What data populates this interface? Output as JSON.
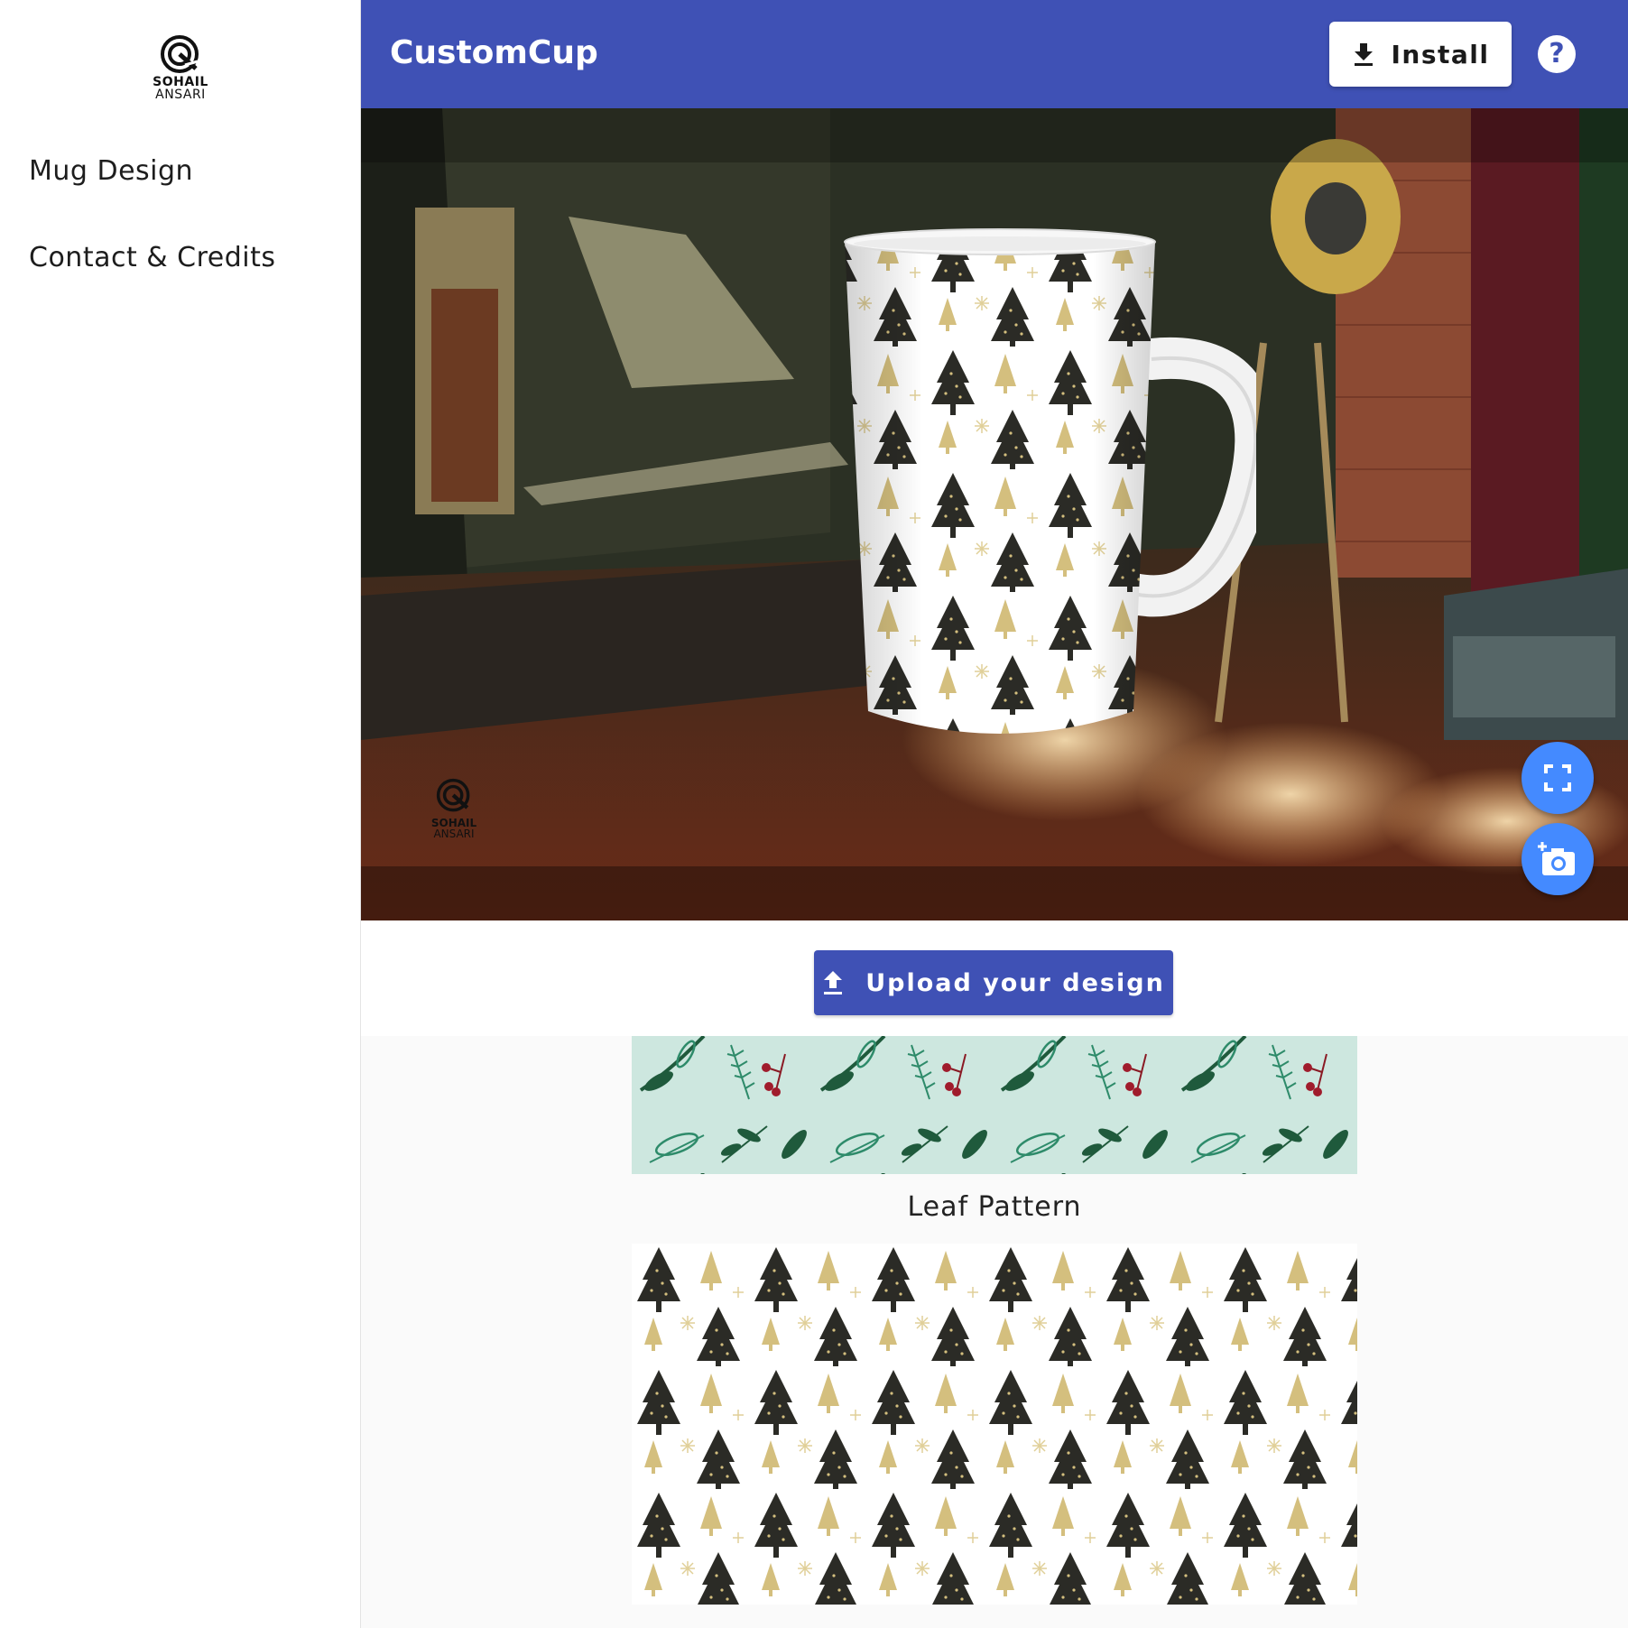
{
  "sidebar": {
    "brand": {
      "line1": "SOHAIL",
      "line2": "ANSARI"
    },
    "items": [
      {
        "label": "Mug Design"
      },
      {
        "label": "Contact & Credits"
      }
    ]
  },
  "header": {
    "title": "CustomCup",
    "install_label": "Install",
    "help_icon": "?"
  },
  "viewer": {
    "watermark": {
      "line1": "SOHAIL",
      "line2": "ANSARI"
    },
    "fullscreen_icon": "fullscreen-icon",
    "screenshot_icon": "add-photo-icon"
  },
  "upload": {
    "label": "Upload your design"
  },
  "gallery": {
    "patterns": [
      {
        "caption": "Leaf Pattern"
      },
      {
        "caption": ""
      }
    ]
  },
  "colors": {
    "primary": "#3f51b5",
    "fab": "#448aff",
    "leaf_bg": "#cde7df",
    "leaf_dark": "#1f5a3c",
    "berry": "#a01c2c",
    "tree_dark": "#2b2b26",
    "tree_gold": "#d4bf7e"
  }
}
